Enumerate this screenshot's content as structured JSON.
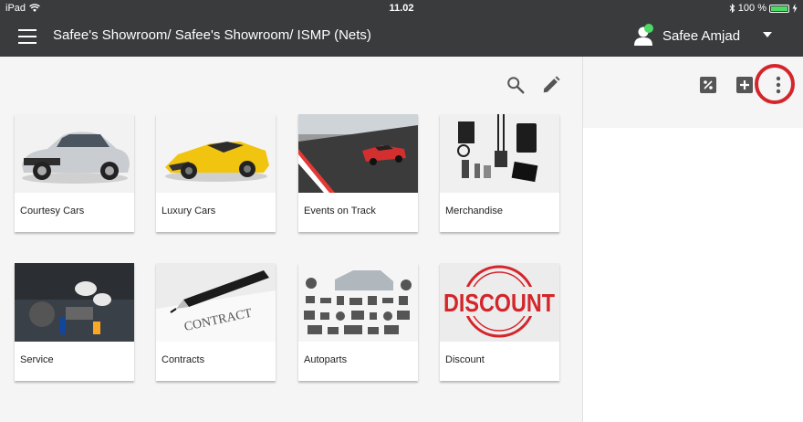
{
  "status_bar": {
    "device": "iPad",
    "time": "11.02",
    "battery": "100 %",
    "battery_level": 1.0
  },
  "header": {
    "title": "Safee's Showroom/ Safee's Showroom/ ISMP (Nets)",
    "user_name": "Safee Amjad"
  },
  "toolbar": {
    "search_icon": "search-icon",
    "edit_icon": "pencil-icon"
  },
  "right_toolbar": {
    "percent_icon": "percent-icon",
    "add_icon": "add-box-icon",
    "more_icon": "more-vertical-icon"
  },
  "categories": [
    {
      "label": "Courtesy Cars"
    },
    {
      "label": "Luxury Cars"
    },
    {
      "label": "Events on Track"
    },
    {
      "label": "Merchandise"
    },
    {
      "label": "Service"
    },
    {
      "label": "Contracts"
    },
    {
      "label": "Autoparts"
    },
    {
      "label": "Discount"
    }
  ],
  "discount_image_text": "DISCOUNT",
  "contract_image_text": "CONTRACT",
  "colors": {
    "header_bg": "#3a3b3d",
    "panel_bg": "#f5f5f5",
    "accent_red": "#d4252a",
    "online_green": "#4cd964"
  }
}
